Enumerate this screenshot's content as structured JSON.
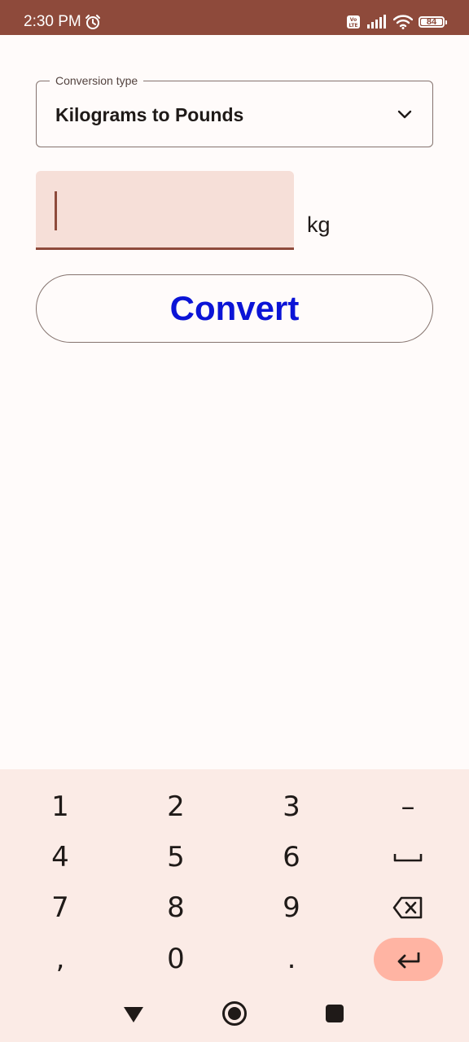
{
  "status_bar": {
    "time": "2:30 PM",
    "battery_level": "84",
    "alarm_icon": "alarm-clock-icon",
    "volte_icon": "volte-icon",
    "signal_icon": "cell-signal-icon",
    "wifi_icon": "wifi-icon",
    "color": "#8e4a3b"
  },
  "conversion": {
    "label": "Conversion type",
    "selected": "Kilograms to Pounds",
    "chevron_icon": "chevron-down-icon"
  },
  "input": {
    "value": "",
    "placeholder": "",
    "unit": "kg"
  },
  "convert_button": {
    "label": "Convert",
    "color": "#0b14d6"
  },
  "keyboard": {
    "keys": [
      [
        "1",
        "2",
        "3",
        "–"
      ],
      [
        "4",
        "5",
        "6",
        "space"
      ],
      [
        "7",
        "8",
        "9",
        "backspace"
      ],
      [
        ",",
        "0",
        ".",
        "enter"
      ]
    ],
    "space_icon": "space-icon",
    "backspace_icon": "backspace-icon",
    "enter_icon": "enter-icon",
    "enter_color": "#ffb4a3"
  },
  "navigation": {
    "back_icon": "nav-back-icon",
    "home_icon": "nav-home-icon",
    "recents_icon": "nav-recents-icon"
  }
}
